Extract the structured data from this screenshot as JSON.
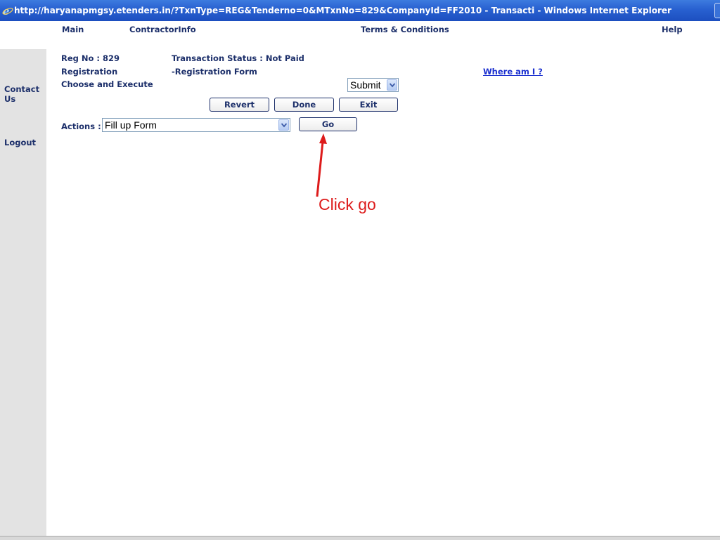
{
  "window": {
    "title": "http://haryanapmgsy.etenders.in/?TxnType=REG&Tenderno=0&MTxnNo=829&CompanyId=FF2010 - Transacti - Windows Internet Explorer"
  },
  "nav": {
    "main": "Main",
    "contractor_info": "ContractorInfo",
    "terms": "Terms & Conditions",
    "help": "Help"
  },
  "sidebar": {
    "contact_line1": "Contact",
    "contact_line2": "Us",
    "logout": "Logout"
  },
  "info": {
    "reg_no": "Reg No : 829",
    "transaction_status": "Transaction Status : Not Paid",
    "registration": "Registration",
    "registration_form": "-Registration Form",
    "choose_execute": "Choose and Execute",
    "where_am_i": "Where am I ?"
  },
  "execute_select": {
    "value": "Submit"
  },
  "buttons": {
    "revert": "Revert",
    "done": "Done",
    "exit": "Exit",
    "go": "Go"
  },
  "actions": {
    "label": "Actions :",
    "value": "Fill up Form"
  },
  "annotation": {
    "text": "Click go",
    "color": "#dd1b1b"
  }
}
